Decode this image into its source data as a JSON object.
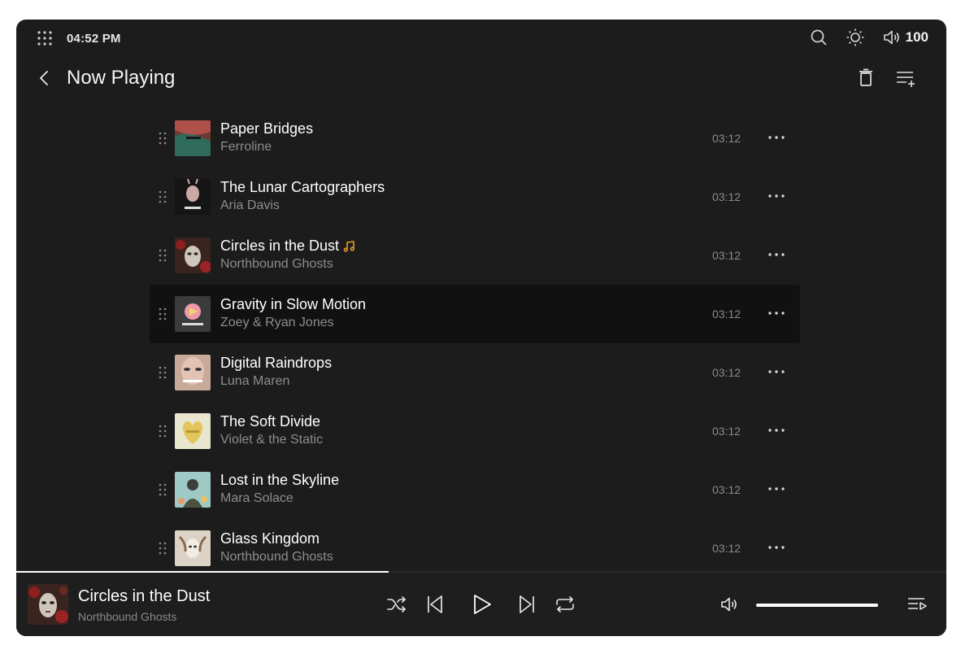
{
  "status_bar": {
    "time": "04:52 PM",
    "volume_level": "100",
    "icons": [
      "apps-grid-icon",
      "search-icon",
      "brightness-icon",
      "volume-icon"
    ]
  },
  "header": {
    "title": "Now Playing",
    "icons": [
      "back-chevron-icon",
      "trash-icon",
      "playlist-add-icon"
    ]
  },
  "queue": [
    {
      "title": "Paper Bridges",
      "artist": "Ferroline",
      "duration": "03:12",
      "playing": false,
      "active": false
    },
    {
      "title": "The Lunar Cartographers",
      "artist": "Aria Davis",
      "duration": "03:12",
      "playing": false,
      "active": false
    },
    {
      "title": "Circles in the Dust",
      "artist": "Northbound Ghosts",
      "duration": "03:12",
      "playing": true,
      "active": false
    },
    {
      "title": "Gravity in Slow Motion",
      "artist": "Zoey & Ryan Jones",
      "duration": "03:12",
      "playing": false,
      "active": true
    },
    {
      "title": "Digital Raindrops",
      "artist": "Luna Maren",
      "duration": "03:12",
      "playing": false,
      "active": false
    },
    {
      "title": "The Soft Divide",
      "artist": "Violet & the Static",
      "duration": "03:12",
      "playing": false,
      "active": false
    },
    {
      "title": "Lost in the Skyline",
      "artist": "Mara Solace",
      "duration": "03:12",
      "playing": false,
      "active": false
    },
    {
      "title": "Glass Kingdom",
      "artist": "Northbound Ghosts",
      "duration": "03:12",
      "playing": false,
      "active": false
    }
  ],
  "player": {
    "title": "Circles in the Dust",
    "artist": "Northbound Ghosts",
    "progress": 0.4,
    "volume": 1.0
  },
  "colors": {
    "background": "#1c1c1c",
    "active_row": "#111111",
    "playing_indicator": "#e39a2b",
    "muted_text": "#8d8d8d"
  }
}
